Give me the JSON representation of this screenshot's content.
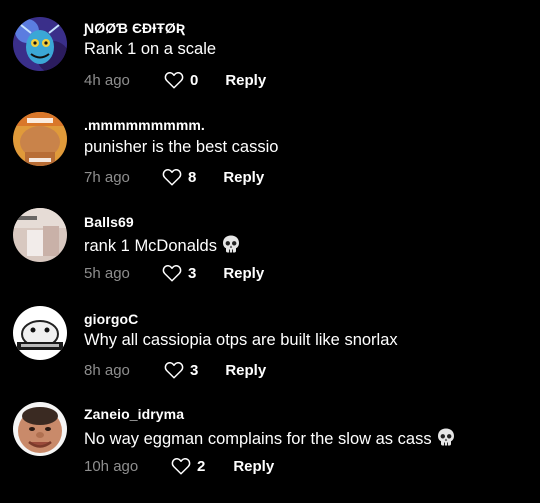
{
  "colors": {
    "background": "#000000",
    "text": "#ffffff",
    "muted": "#8e8e8e"
  },
  "reply_label": "Reply",
  "comments": [
    {
      "username": "ƝØØƁ ЄĐƗŦØƦ",
      "text": "Rank 1 on a scale",
      "emoji": "",
      "time": "4h ago",
      "likes": "0"
    },
    {
      "username": ".mmmmmmmmm.",
      "text": "punisher is the best cassio",
      "emoji": "",
      "time": "7h ago",
      "likes": "8"
    },
    {
      "username": "Balls69",
      "text": "rank 1 McDonalds",
      "emoji": "skull-emoji",
      "time": "5h ago",
      "likes": "3"
    },
    {
      "username": "giorgoC",
      "text": "Why all cassiopia otps are built like snorlax",
      "emoji": "",
      "time": "8h ago",
      "likes": "3"
    },
    {
      "username": "Zaneio_idryma",
      "text": "No way eggman complains for the slow as cass",
      "emoji": "skull-emoji",
      "time": "10h ago",
      "likes": "2"
    }
  ]
}
